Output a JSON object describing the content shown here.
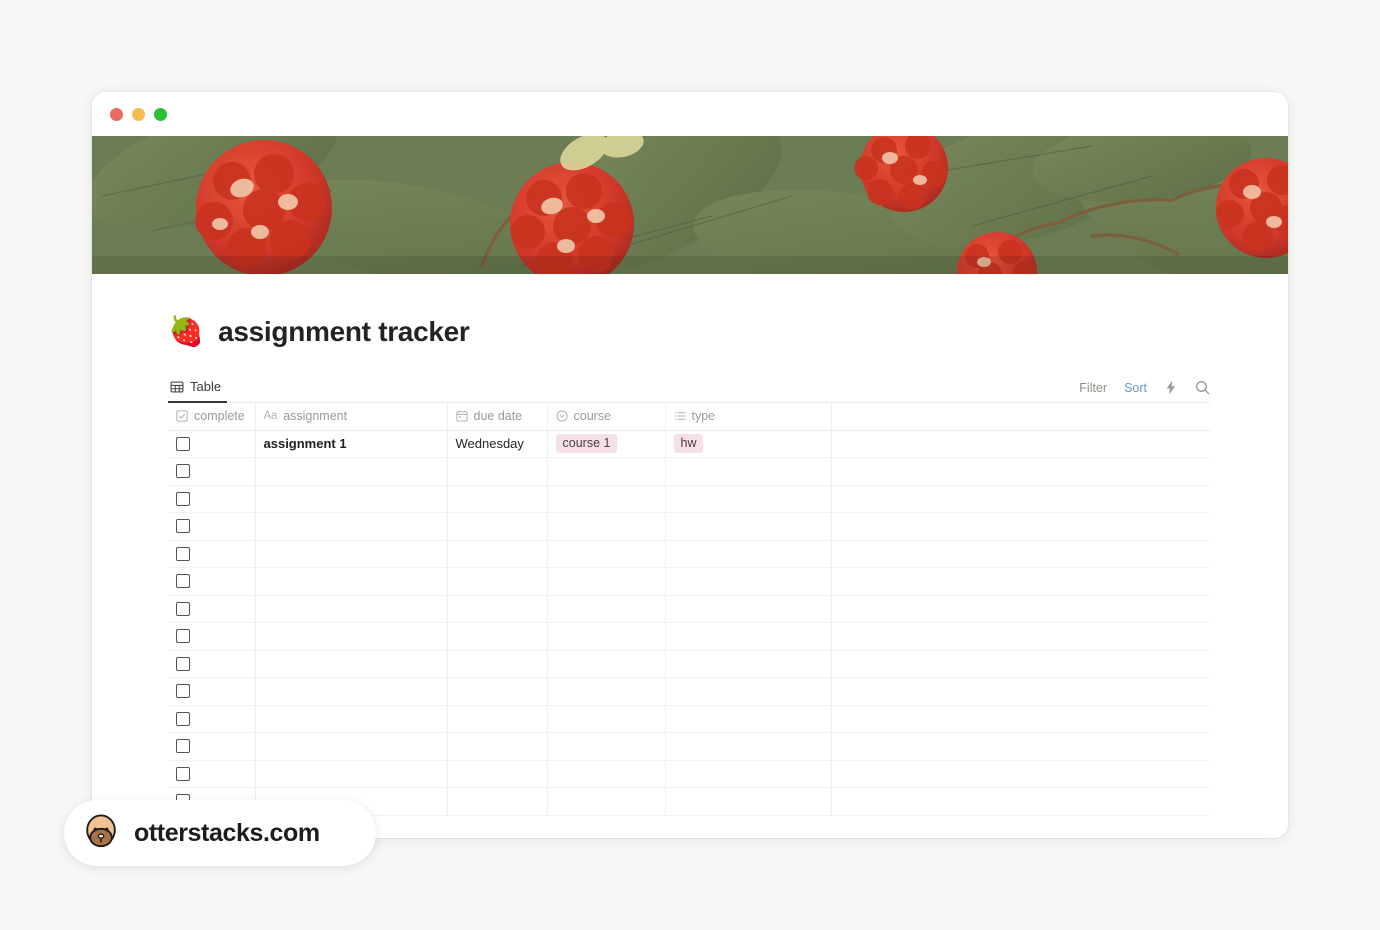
{
  "window": {
    "traffic_lights": [
      "close",
      "minimize",
      "zoom"
    ]
  },
  "cover": {
    "name": "raspberry-botanical-illustration",
    "colors": {
      "leaf_green": "#6d7f55",
      "berry_red": "#d93f2e",
      "berry_highlight": "#f0c4a4",
      "stem_brown": "#7a5c3a"
    }
  },
  "page": {
    "emoji": "🍓",
    "title": "assignment tracker"
  },
  "views": [
    {
      "label": "Table",
      "icon": "table-icon",
      "active": true
    }
  ],
  "toolbar": {
    "filter_label": "Filter",
    "sort_label": "Sort",
    "sort_color": "#6a9bbd",
    "automation_icon": "lightning-icon",
    "search_icon": "search-icon"
  },
  "table": {
    "columns": [
      {
        "key": "complete",
        "label": "complete",
        "icon": "checkbox-icon"
      },
      {
        "key": "assignment",
        "label": "assignment",
        "icon": "aa-text-icon"
      },
      {
        "key": "due_date",
        "label": "due date",
        "icon": "calendar-icon"
      },
      {
        "key": "course",
        "label": "course",
        "icon": "select-circle-icon"
      },
      {
        "key": "type",
        "label": "type",
        "icon": "multiselect-list-icon"
      },
      {
        "key": "blank",
        "label": "",
        "icon": ""
      }
    ],
    "rows": [
      {
        "complete": false,
        "assignment": "assignment 1",
        "due_date": "Wednesday",
        "course": "course 1",
        "type": "hw"
      },
      {
        "complete": false,
        "assignment": "",
        "due_date": "",
        "course": "",
        "type": ""
      },
      {
        "complete": false,
        "assignment": "",
        "due_date": "",
        "course": "",
        "type": ""
      },
      {
        "complete": false,
        "assignment": "",
        "due_date": "",
        "course": "",
        "type": ""
      },
      {
        "complete": false,
        "assignment": "",
        "due_date": "",
        "course": "",
        "type": ""
      },
      {
        "complete": false,
        "assignment": "",
        "due_date": "",
        "course": "",
        "type": ""
      },
      {
        "complete": false,
        "assignment": "",
        "due_date": "",
        "course": "",
        "type": ""
      },
      {
        "complete": false,
        "assignment": "",
        "due_date": "",
        "course": "",
        "type": ""
      },
      {
        "complete": false,
        "assignment": "",
        "due_date": "",
        "course": "",
        "type": ""
      },
      {
        "complete": false,
        "assignment": "",
        "due_date": "",
        "course": "",
        "type": ""
      },
      {
        "complete": false,
        "assignment": "",
        "due_date": "",
        "course": "",
        "type": ""
      },
      {
        "complete": false,
        "assignment": "",
        "due_date": "",
        "course": "",
        "type": ""
      },
      {
        "complete": false,
        "assignment": "",
        "due_date": "",
        "course": "",
        "type": ""
      },
      {
        "complete": false,
        "assignment": "",
        "due_date": "",
        "course": "",
        "type": ""
      }
    ],
    "tag_colors": {
      "course": "#f5e0e9",
      "type": "#f5e0e9"
    }
  },
  "watermark": {
    "text": "otterstacks.com",
    "logo": "otter-face-icon"
  }
}
